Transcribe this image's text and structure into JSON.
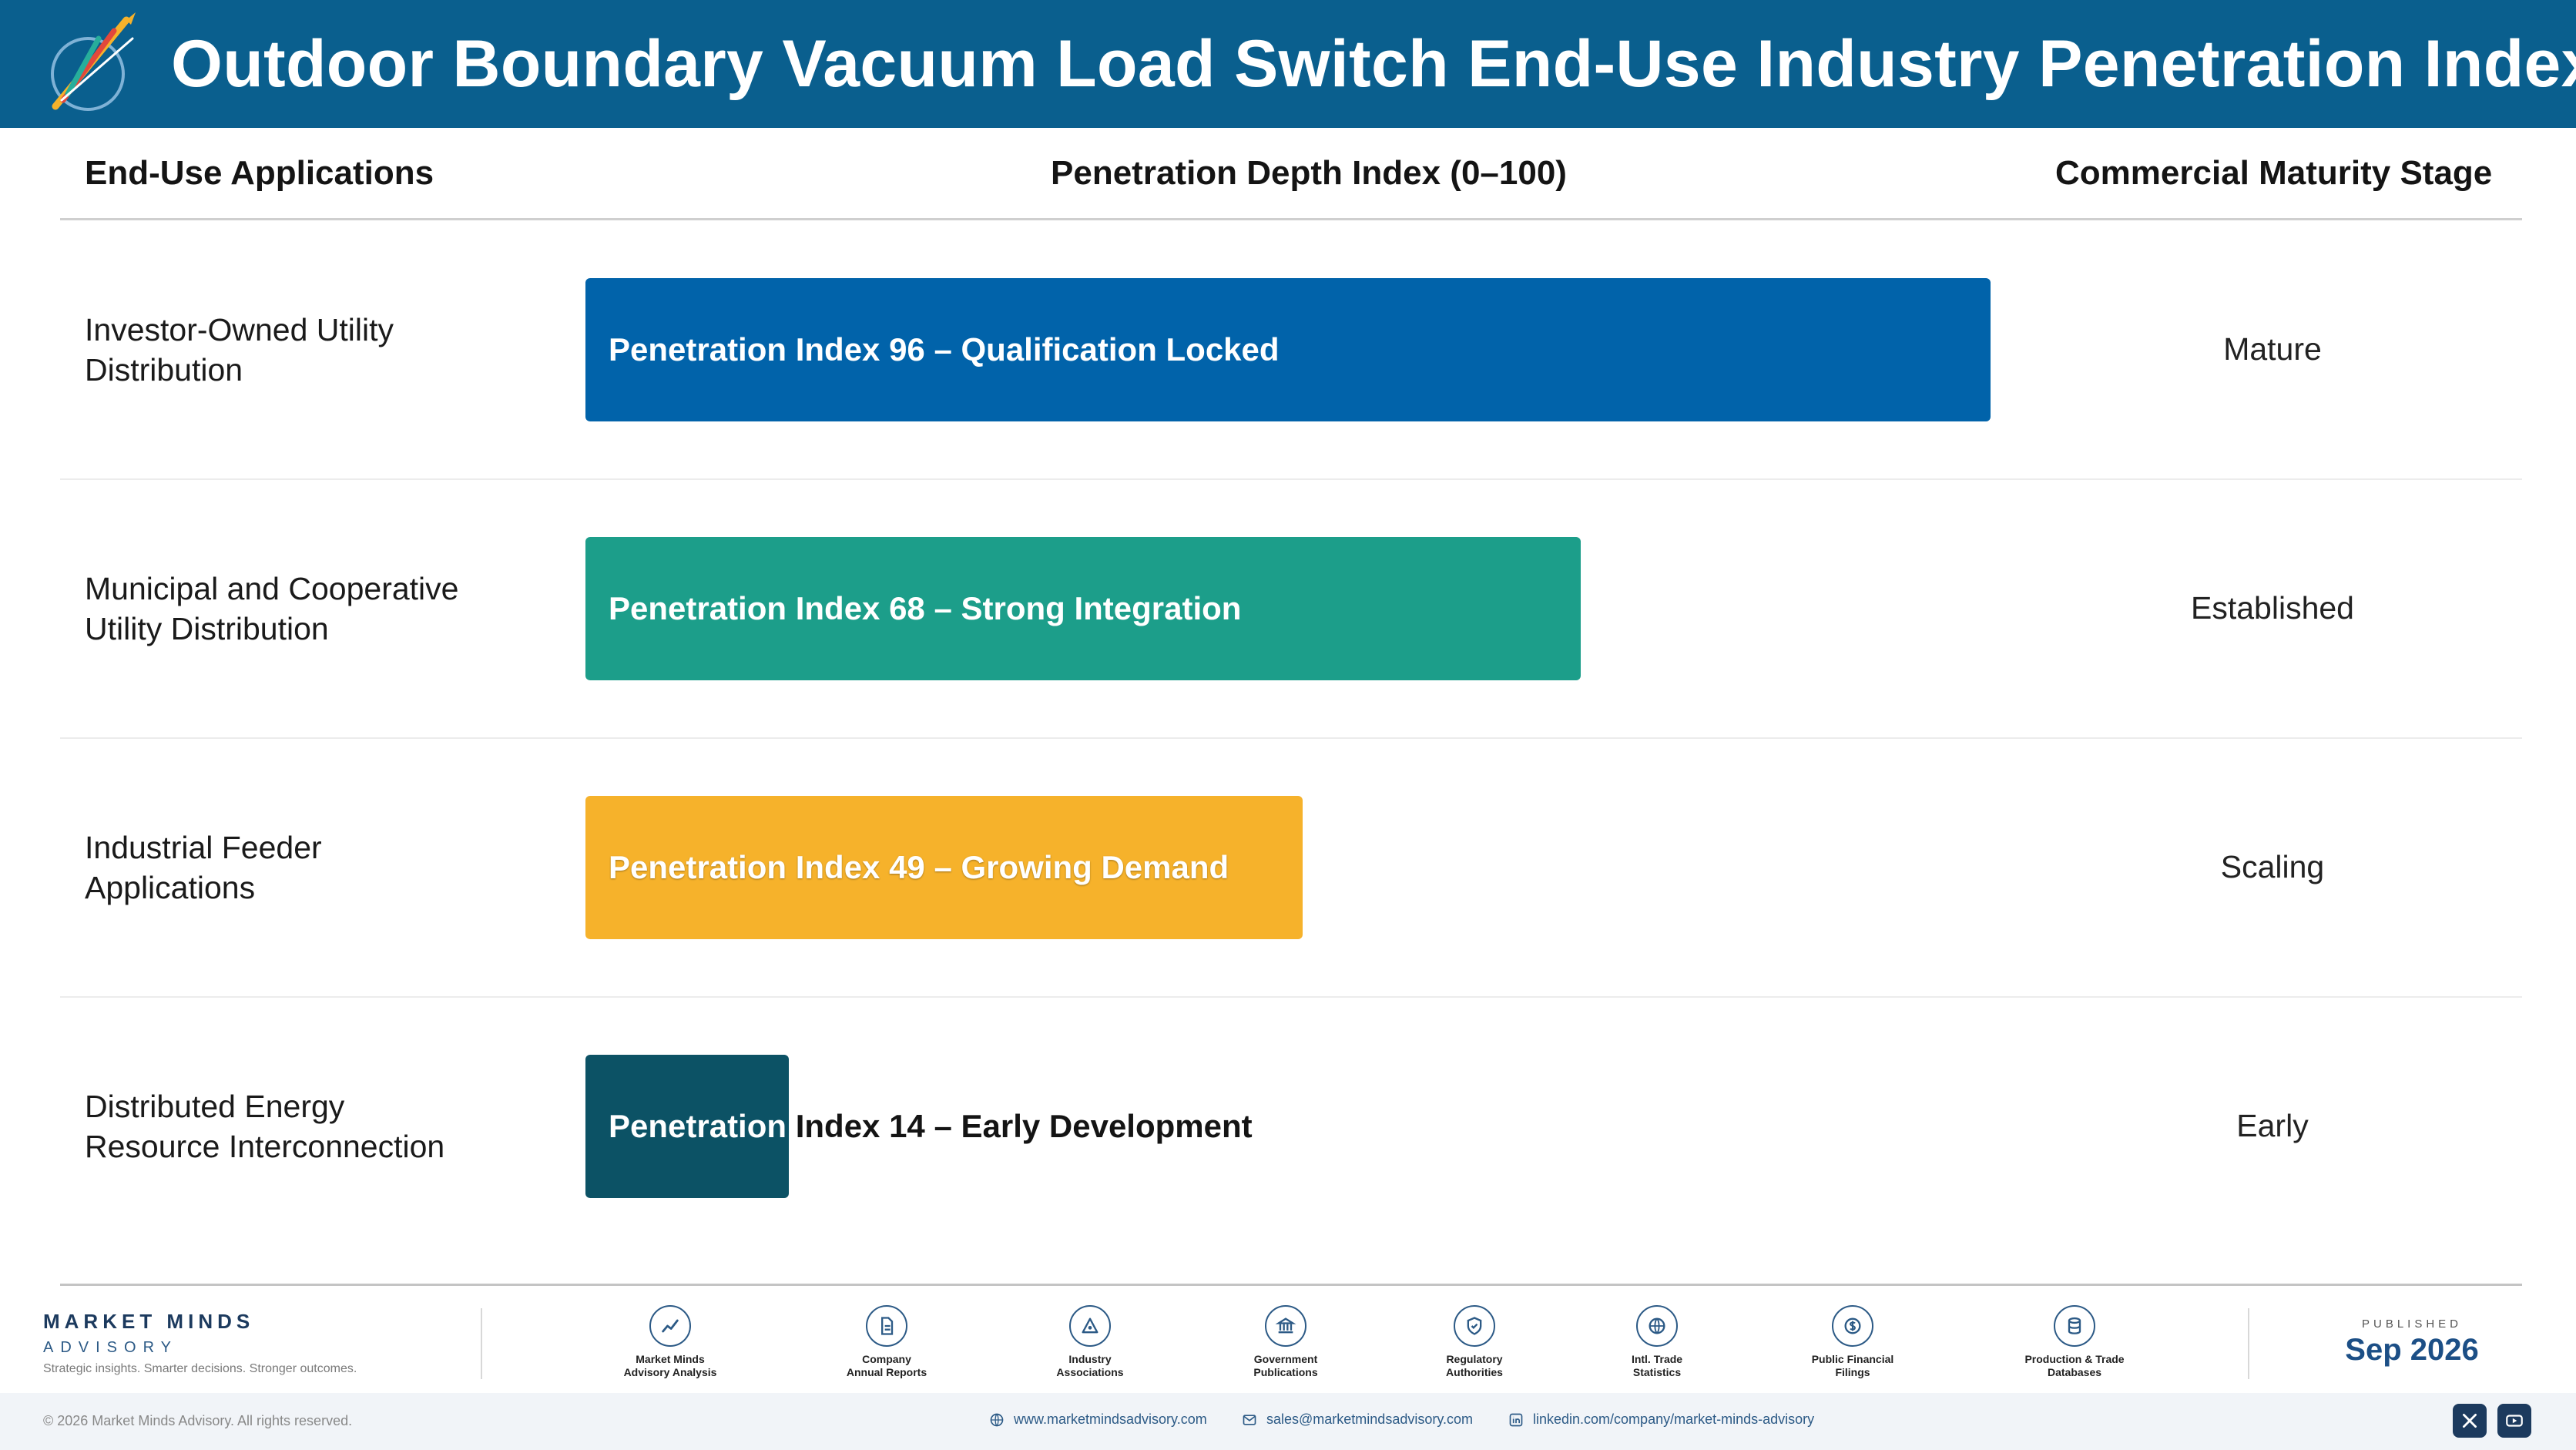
{
  "header": {
    "title": "Outdoor Boundary Vacuum Load Switch End-Use Industry Penetration Index",
    "logo_caption": "Market Minds Advisory"
  },
  "columns": {
    "applications": "End-Use Applications",
    "index": "Penetration Depth Index (0–100)",
    "stage": "Commercial Maturity Stage"
  },
  "chart_data": {
    "type": "bar",
    "orientation": "horizontal",
    "xlim": [
      0,
      100
    ],
    "categories": [
      "Investor-Owned Utility Distribution",
      "Municipal and Cooperative Utility Distribution",
      "Industrial Feeder Applications",
      "Distributed Energy Resource Interconnection"
    ],
    "values": [
      96,
      68,
      49,
      14
    ],
    "rows": [
      {
        "application": [
          "Investor-Owned Utility",
          "Distribution"
        ],
        "value": 96,
        "label": "Penetration Index 96 – Qualification Locked",
        "stage": "Mature",
        "color": "#0163aa",
        "text_color": "#ffffff"
      },
      {
        "application": [
          "Municipal and Cooperative",
          "Utility Distribution"
        ],
        "value": 68,
        "label": "Penetration Index 68 – Strong Integration",
        "stage": "Established",
        "color": "#1c9e8a",
        "text_color": "#ffffff"
      },
      {
        "application": [
          "Industrial Feeder",
          "Applications"
        ],
        "value": 49,
        "label": "Penetration Index 49 – Growing Demand",
        "stage": "Scaling",
        "color": "#f6b22b",
        "text_color": "#ffffff"
      },
      {
        "application": [
          "Distributed Energy",
          "Resource Interconnection"
        ],
        "value": 14,
        "label": "Penetration Index 14 – Early Development",
        "stage": "Early",
        "color": "#0c5265",
        "text_color": "#ffffff"
      }
    ]
  },
  "footer": {
    "brand_name": "MARKET MINDS",
    "brand_sub": "ADVISORY",
    "tagline": "Strategic insights. Smarter decisions. Stronger outcomes.",
    "sources": [
      {
        "icon": "trend-chart-icon",
        "line1": "Market Minds",
        "line2": "Advisory Analysis"
      },
      {
        "icon": "document-icon",
        "line1": "Company",
        "line2": "Annual Reports"
      },
      {
        "icon": "network-icon",
        "line1": "Industry",
        "line2": "Associations"
      },
      {
        "icon": "government-building-icon",
        "line1": "Government",
        "line2": "Publications"
      },
      {
        "icon": "shield-check-icon",
        "line1": "Regulatory",
        "line2": "Authorities"
      },
      {
        "icon": "globe-icon",
        "line1": "Intl. Trade",
        "line2": "Statistics"
      },
      {
        "icon": "dollar-coin-icon",
        "line1": "Public Financial",
        "line2": "Filings"
      },
      {
        "icon": "database-icon",
        "line1": "Production & Trade",
        "line2": "Databases"
      }
    ],
    "published_label": "PUBLISHED",
    "published_date": "Sep 2026",
    "copyright": "© 2026 Market Minds Advisory. All rights reserved.",
    "website": "www.marketmindsadvisory.com",
    "email": "sales@marketmindsadvisory.com",
    "linkedin": "linkedin.com/company/market-minds-advisory"
  }
}
